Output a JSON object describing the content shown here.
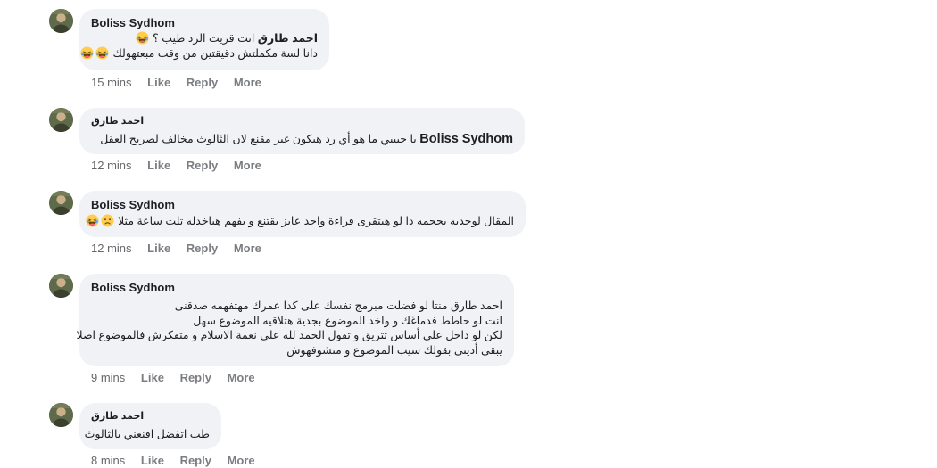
{
  "comments": [
    {
      "author": "Boliss Sydhom",
      "lines": [
        {
          "parts": [
            {
              "t": "احمد طارق",
              "b": true
            },
            {
              "t": " انت قريت الرد طيب ؟ "
            }
          ],
          "emojis": [
            "laughing-emoji"
          ]
        },
        {
          "parts": [
            {
              "t": "دانا لسة مكملتش دقيقتين من وقت مبعتهولك "
            }
          ],
          "emojis": [
            "laughing-emoji",
            "laughing-emoji"
          ]
        }
      ],
      "time": "15 mins"
    },
    {
      "author": "احمد طارق",
      "lines": [
        {
          "mention": "Boliss Sydhom",
          "parts": [
            {
              "t": " يا حبيبي ما هو أي رد هيكون غير مقنع لان الثالوث مخالف لصريح العقل"
            }
          ],
          "emojis": []
        }
      ],
      "time": "12 mins"
    },
    {
      "author": "Boliss Sydhom",
      "lines": [
        {
          "parts": [
            {
              "t": "المقال لوحديه بحجمه دا لو هيتقرى قراءة واحد عايز يقتنع و يفهم هياخدله تلت ساعة مثلا "
            }
          ],
          "emojis": [
            "worried-emoji",
            "laughing-emoji"
          ]
        }
      ],
      "time": "12 mins"
    },
    {
      "author": "Boliss Sydhom",
      "lines": [
        {
          "parts": [
            {
              "t": "احمد طارق منتا لو فضلت مبرمج نفسك على كدا عمرك مهتفهمه صدقنى"
            }
          ],
          "emojis": []
        },
        {
          "parts": [
            {
              "t": "انت لو حاطط فدماغك و واخد الموضوع بجدية هتلاقيه الموضوع سهل"
            }
          ],
          "emojis": []
        },
        {
          "parts": [
            {
              "t": "لكن لو داخل على أساس تتريق و تقول الحمد لله على نعمة الاسلام و متفكرش فالموضوع اصلا"
            }
          ],
          "emojis": []
        },
        {
          "parts": [
            {
              "t": "يبقى أدينى بقولك سيب الموضوع و متشوفهوش"
            }
          ],
          "emojis": []
        }
      ],
      "time": "9 mins"
    },
    {
      "author": "احمد طارق",
      "lines": [
        {
          "parts": [
            {
              "t": "طب اتفضل اقنعني بالثالوث"
            }
          ],
          "emojis": []
        }
      ],
      "time": "8 mins"
    }
  ],
  "actions": {
    "like": "Like",
    "reply": "Reply",
    "more": "More"
  }
}
